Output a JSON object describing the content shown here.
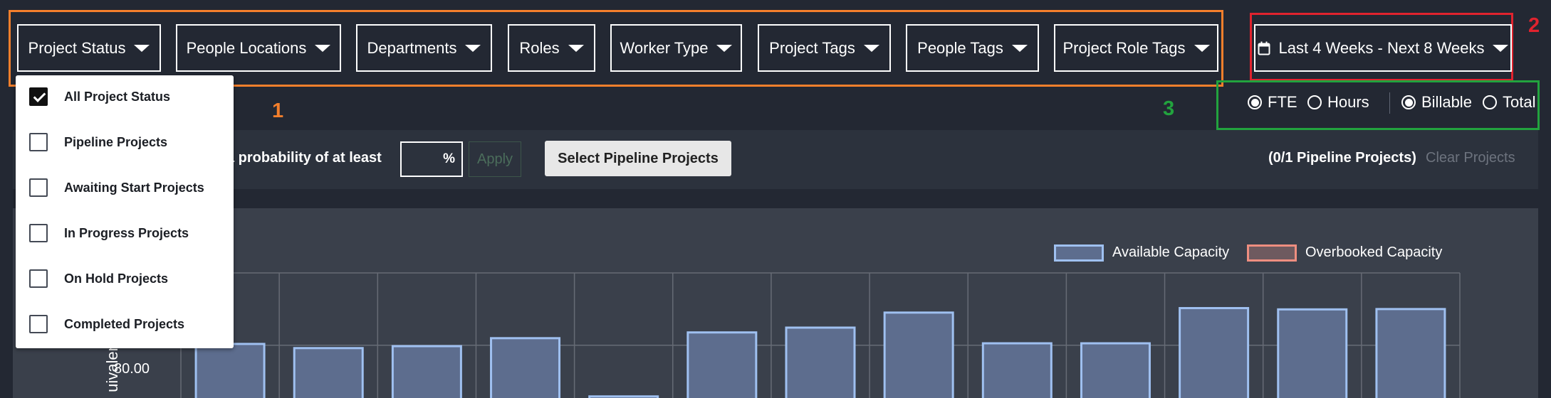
{
  "filters": [
    {
      "key": "project-status",
      "label": "Project Status"
    },
    {
      "key": "people-locations",
      "label": "People Locations"
    },
    {
      "key": "departments",
      "label": "Departments"
    },
    {
      "key": "roles",
      "label": "Roles"
    },
    {
      "key": "worker-type",
      "label": "Worker Type"
    },
    {
      "key": "project-tags",
      "label": "Project Tags"
    },
    {
      "key": "people-tags",
      "label": "People Tags"
    },
    {
      "key": "project-role-tags",
      "label": "Project Role Tags"
    }
  ],
  "date_range": {
    "label": "Last 4 Weeks - Next 8 Weeks",
    "icon": "calendar-icon"
  },
  "annotations": {
    "one": "1",
    "two": "2",
    "three": "3",
    "color_one": "#f47f2c",
    "color_two": "#e0232e",
    "color_three": "#22a33e"
  },
  "units": {
    "fte": "FTE",
    "hours": "Hours",
    "billable": "Billable",
    "total": "Total",
    "selected_unit": "FTE",
    "selected_type": "Billable"
  },
  "pipeline": {
    "prob_label": "a probability of at least",
    "prob_input_value": "",
    "prob_suffix": "%",
    "apply_label": "Apply",
    "select_button": "Select Pipeline Projects",
    "count_text": "(0/1 Pipeline Projects)",
    "clear_label": "Clear Projects"
  },
  "status_dropdown": {
    "items": [
      {
        "label": "All Project Status",
        "checked": true
      },
      {
        "label": "Pipeline Projects",
        "checked": false
      },
      {
        "label": "Awaiting Start Projects",
        "checked": false
      },
      {
        "label": "In Progress Projects",
        "checked": false
      },
      {
        "label": "On Hold Projects",
        "checked": false
      },
      {
        "label": "Completed Projects",
        "checked": false
      }
    ]
  },
  "legend": {
    "available": "Available Capacity",
    "overbooked": "Overbooked Capacity",
    "available_fill": "#5d6d8e",
    "available_stroke": "#9fc0f0",
    "overbooked_fill": "#6e5a5f",
    "overbooked_stroke": "#ee8e80"
  },
  "chart_data": {
    "type": "bar",
    "ylabel_partial": "uivalen",
    "y_ticks": [
      80
    ],
    "y_tick_labels": [
      "80.00"
    ],
    "visible_ylim": [
      63.5,
      102.6
    ],
    "series": [
      {
        "name": "Available Capacity",
        "values": [
          80.4,
          79.1,
          79.7,
          82.2,
          64.0,
          84.0,
          85.5,
          90.2,
          80.6,
          80.6,
          91.6,
          91.2,
          91.3
        ]
      }
    ]
  }
}
